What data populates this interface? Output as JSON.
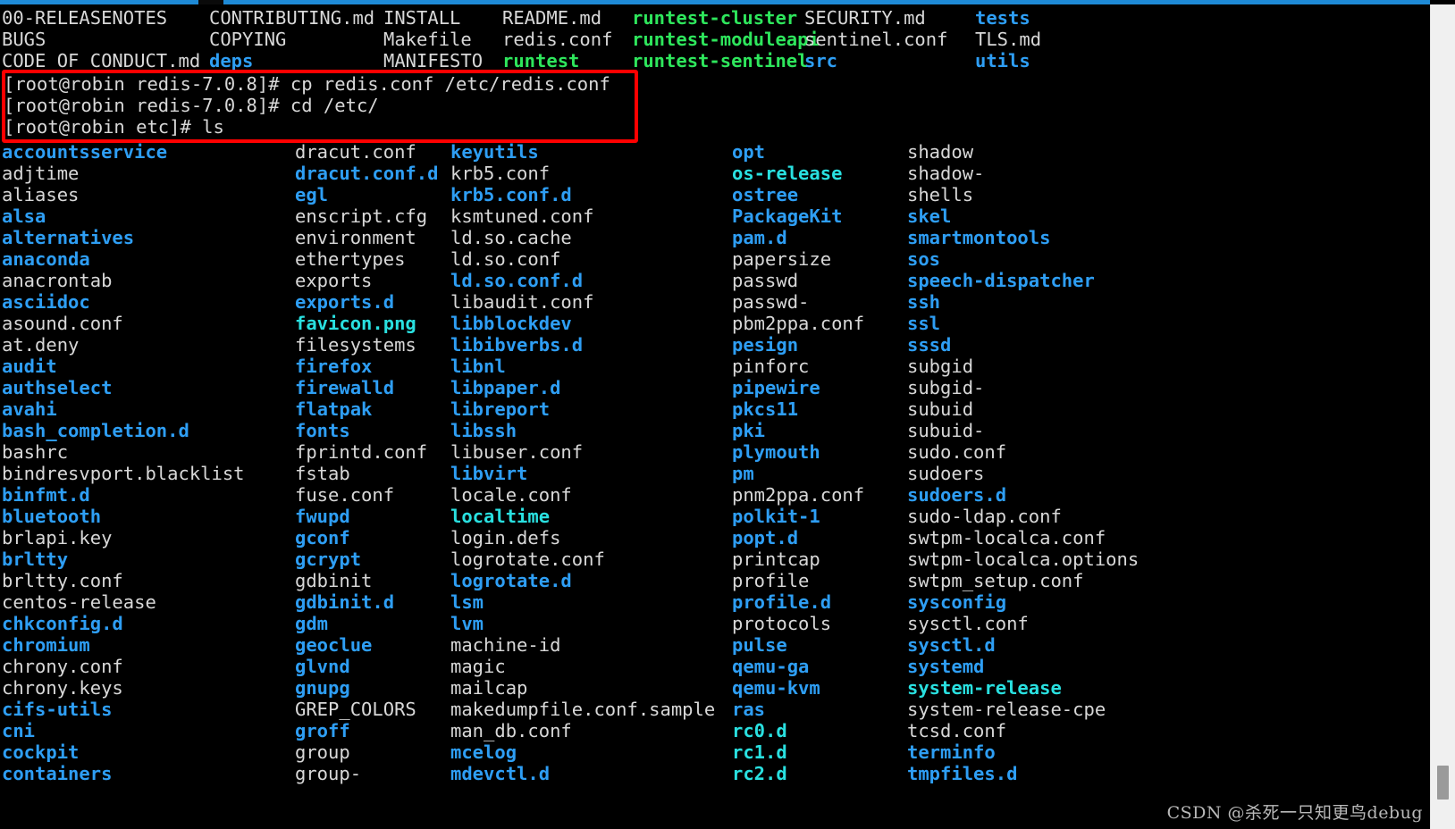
{
  "window": {
    "top_edge_color": "#1e8ad6",
    "background_color": "#000000"
  },
  "terminal": {
    "colors": {
      "white": "#d8d8d8",
      "directory_blue": "#2e9ef4",
      "executable_green": "#2ee65c",
      "symlink_cyan": "#29e0e0",
      "highlight_red": "#ff0000"
    },
    "previous_listing": {
      "description": "output of ls in redis-7.0.8 source directory",
      "rows": [
        [
          {
            "t": "00-RELEASENOTES",
            "c": "white"
          },
          {
            "t": "CONTRIBUTING.md",
            "c": "white"
          },
          {
            "t": "INSTALL",
            "c": "white"
          },
          {
            "t": "README.md",
            "c": "white"
          },
          {
            "t": "runtest-cluster",
            "c": "green"
          },
          {
            "t": "SECURITY.md",
            "c": "white"
          },
          {
            "t": "tests",
            "c": "blue"
          }
        ],
        [
          {
            "t": "BUGS",
            "c": "white"
          },
          {
            "t": "COPYING",
            "c": "white"
          },
          {
            "t": "Makefile",
            "c": "white"
          },
          {
            "t": "redis.conf",
            "c": "white"
          },
          {
            "t": "runtest-moduleapi",
            "c": "green"
          },
          {
            "t": "sentinel.conf",
            "c": "white"
          },
          {
            "t": "TLS.md",
            "c": "white"
          }
        ],
        [
          {
            "t": "CODE_OF_CONDUCT.md",
            "c": "white"
          },
          {
            "t": "deps",
            "c": "blue"
          },
          {
            "t": "MANIFESTO",
            "c": "white"
          },
          {
            "t": "runtest",
            "c": "green"
          },
          {
            "t": "runtest-sentinel",
            "c": "green"
          },
          {
            "t": "src",
            "c": "blue"
          },
          {
            "t": "utils",
            "c": "blue"
          }
        ]
      ]
    },
    "commands": [
      "[root@robin redis-7.0.8]# cp redis.conf /etc/redis.conf",
      "[root@robin redis-7.0.8]# cd /etc/",
      "[root@robin etc]# ls"
    ],
    "etc_listing": {
      "description": "output of ls in /etc",
      "rows": [
        [
          {
            "t": "accountsservice",
            "c": "blue"
          },
          {
            "t": "dracut.conf",
            "c": "white"
          },
          {
            "t": "keyutils",
            "c": "blue"
          },
          {
            "t": "opt",
            "c": "blue"
          },
          {
            "t": "shadow",
            "c": "white"
          }
        ],
        [
          {
            "t": "adjtime",
            "c": "white"
          },
          {
            "t": "dracut.conf.d",
            "c": "blue"
          },
          {
            "t": "krb5.conf",
            "c": "white"
          },
          {
            "t": "os-release",
            "c": "cyan"
          },
          {
            "t": "shadow-",
            "c": "white"
          }
        ],
        [
          {
            "t": "aliases",
            "c": "white"
          },
          {
            "t": "egl",
            "c": "blue"
          },
          {
            "t": "krb5.conf.d",
            "c": "blue"
          },
          {
            "t": "ostree",
            "c": "blue"
          },
          {
            "t": "shells",
            "c": "white"
          }
        ],
        [
          {
            "t": "alsa",
            "c": "blue"
          },
          {
            "t": "enscript.cfg",
            "c": "white"
          },
          {
            "t": "ksmtuned.conf",
            "c": "white"
          },
          {
            "t": "PackageKit",
            "c": "blue"
          },
          {
            "t": "skel",
            "c": "blue"
          }
        ],
        [
          {
            "t": "alternatives",
            "c": "blue"
          },
          {
            "t": "environment",
            "c": "white"
          },
          {
            "t": "ld.so.cache",
            "c": "white"
          },
          {
            "t": "pam.d",
            "c": "blue"
          },
          {
            "t": "smartmontools",
            "c": "blue"
          }
        ],
        [
          {
            "t": "anaconda",
            "c": "blue"
          },
          {
            "t": "ethertypes",
            "c": "white"
          },
          {
            "t": "ld.so.conf",
            "c": "white"
          },
          {
            "t": "papersize",
            "c": "white"
          },
          {
            "t": "sos",
            "c": "blue"
          }
        ],
        [
          {
            "t": "anacrontab",
            "c": "white"
          },
          {
            "t": "exports",
            "c": "white"
          },
          {
            "t": "ld.so.conf.d",
            "c": "blue"
          },
          {
            "t": "passwd",
            "c": "white"
          },
          {
            "t": "speech-dispatcher",
            "c": "blue"
          }
        ],
        [
          {
            "t": "asciidoc",
            "c": "blue"
          },
          {
            "t": "exports.d",
            "c": "blue"
          },
          {
            "t": "libaudit.conf",
            "c": "white"
          },
          {
            "t": "passwd-",
            "c": "white"
          },
          {
            "t": "ssh",
            "c": "blue"
          }
        ],
        [
          {
            "t": "asound.conf",
            "c": "white"
          },
          {
            "t": "favicon.png",
            "c": "cyan"
          },
          {
            "t": "libblockdev",
            "c": "blue"
          },
          {
            "t": "pbm2ppa.conf",
            "c": "white"
          },
          {
            "t": "ssl",
            "c": "blue"
          }
        ],
        [
          {
            "t": "at.deny",
            "c": "white"
          },
          {
            "t": "filesystems",
            "c": "white"
          },
          {
            "t": "libibverbs.d",
            "c": "blue"
          },
          {
            "t": "pesign",
            "c": "blue"
          },
          {
            "t": "sssd",
            "c": "blue"
          }
        ],
        [
          {
            "t": "audit",
            "c": "blue"
          },
          {
            "t": "firefox",
            "c": "blue"
          },
          {
            "t": "libnl",
            "c": "blue"
          },
          {
            "t": "pinforc",
            "c": "white"
          },
          {
            "t": "subgid",
            "c": "white"
          }
        ],
        [
          {
            "t": "authselect",
            "c": "blue"
          },
          {
            "t": "firewalld",
            "c": "blue"
          },
          {
            "t": "libpaper.d",
            "c": "blue"
          },
          {
            "t": "pipewire",
            "c": "blue"
          },
          {
            "t": "subgid-",
            "c": "white"
          }
        ],
        [
          {
            "t": "avahi",
            "c": "blue"
          },
          {
            "t": "flatpak",
            "c": "blue"
          },
          {
            "t": "libreport",
            "c": "blue"
          },
          {
            "t": "pkcs11",
            "c": "blue"
          },
          {
            "t": "subuid",
            "c": "white"
          }
        ],
        [
          {
            "t": "bash_completion.d",
            "c": "blue"
          },
          {
            "t": "fonts",
            "c": "blue"
          },
          {
            "t": "libssh",
            "c": "blue"
          },
          {
            "t": "pki",
            "c": "blue"
          },
          {
            "t": "subuid-",
            "c": "white"
          }
        ],
        [
          {
            "t": "bashrc",
            "c": "white"
          },
          {
            "t": "fprintd.conf",
            "c": "white"
          },
          {
            "t": "libuser.conf",
            "c": "white"
          },
          {
            "t": "plymouth",
            "c": "blue"
          },
          {
            "t": "sudo.conf",
            "c": "white"
          }
        ],
        [
          {
            "t": "bindresvport.blacklist",
            "c": "white"
          },
          {
            "t": "fstab",
            "c": "white"
          },
          {
            "t": "libvirt",
            "c": "blue"
          },
          {
            "t": "pm",
            "c": "blue"
          },
          {
            "t": "sudoers",
            "c": "white"
          }
        ],
        [
          {
            "t": "binfmt.d",
            "c": "blue"
          },
          {
            "t": "fuse.conf",
            "c": "white"
          },
          {
            "t": "locale.conf",
            "c": "white"
          },
          {
            "t": "pnm2ppa.conf",
            "c": "white"
          },
          {
            "t": "sudoers.d",
            "c": "blue"
          }
        ],
        [
          {
            "t": "bluetooth",
            "c": "blue"
          },
          {
            "t": "fwupd",
            "c": "blue"
          },
          {
            "t": "localtime",
            "c": "cyan"
          },
          {
            "t": "polkit-1",
            "c": "blue"
          },
          {
            "t": "sudo-ldap.conf",
            "c": "white"
          }
        ],
        [
          {
            "t": "brlapi.key",
            "c": "white"
          },
          {
            "t": "gconf",
            "c": "blue"
          },
          {
            "t": "login.defs",
            "c": "white"
          },
          {
            "t": "popt.d",
            "c": "blue"
          },
          {
            "t": "swtpm-localca.conf",
            "c": "white"
          }
        ],
        [
          {
            "t": "brltty",
            "c": "blue"
          },
          {
            "t": "gcrypt",
            "c": "blue"
          },
          {
            "t": "logrotate.conf",
            "c": "white"
          },
          {
            "t": "printcap",
            "c": "white"
          },
          {
            "t": "swtpm-localca.options",
            "c": "white"
          }
        ],
        [
          {
            "t": "brltty.conf",
            "c": "white"
          },
          {
            "t": "gdbinit",
            "c": "white"
          },
          {
            "t": "logrotate.d",
            "c": "blue"
          },
          {
            "t": "profile",
            "c": "white"
          },
          {
            "t": "swtpm_setup.conf",
            "c": "white"
          }
        ],
        [
          {
            "t": "centos-release",
            "c": "white"
          },
          {
            "t": "gdbinit.d",
            "c": "blue"
          },
          {
            "t": "lsm",
            "c": "blue"
          },
          {
            "t": "profile.d",
            "c": "blue"
          },
          {
            "t": "sysconfig",
            "c": "blue"
          }
        ],
        [
          {
            "t": "chkconfig.d",
            "c": "blue"
          },
          {
            "t": "gdm",
            "c": "blue"
          },
          {
            "t": "lvm",
            "c": "blue"
          },
          {
            "t": "protocols",
            "c": "white"
          },
          {
            "t": "sysctl.conf",
            "c": "white"
          }
        ],
        [
          {
            "t": "chromium",
            "c": "blue"
          },
          {
            "t": "geoclue",
            "c": "blue"
          },
          {
            "t": "machine-id",
            "c": "white"
          },
          {
            "t": "pulse",
            "c": "blue"
          },
          {
            "t": "sysctl.d",
            "c": "blue"
          }
        ],
        [
          {
            "t": "chrony.conf",
            "c": "white"
          },
          {
            "t": "glvnd",
            "c": "blue"
          },
          {
            "t": "magic",
            "c": "white"
          },
          {
            "t": "qemu-ga",
            "c": "blue"
          },
          {
            "t": "systemd",
            "c": "blue"
          }
        ],
        [
          {
            "t": "chrony.keys",
            "c": "white"
          },
          {
            "t": "gnupg",
            "c": "blue"
          },
          {
            "t": "mailcap",
            "c": "white"
          },
          {
            "t": "qemu-kvm",
            "c": "blue"
          },
          {
            "t": "system-release",
            "c": "cyan"
          }
        ],
        [
          {
            "t": "cifs-utils",
            "c": "blue"
          },
          {
            "t": "GREP_COLORS",
            "c": "white"
          },
          {
            "t": "makedumpfile.conf.sample",
            "c": "white"
          },
          {
            "t": "ras",
            "c": "blue"
          },
          {
            "t": "system-release-cpe",
            "c": "white"
          }
        ],
        [
          {
            "t": "cni",
            "c": "blue"
          },
          {
            "t": "groff",
            "c": "blue"
          },
          {
            "t": "man_db.conf",
            "c": "white"
          },
          {
            "t": "rc0.d",
            "c": "cyan"
          },
          {
            "t": "tcsd.conf",
            "c": "white"
          }
        ],
        [
          {
            "t": "cockpit",
            "c": "blue"
          },
          {
            "t": "group",
            "c": "white"
          },
          {
            "t": "mcelog",
            "c": "blue"
          },
          {
            "t": "rc1.d",
            "c": "cyan"
          },
          {
            "t": "terminfo",
            "c": "blue"
          }
        ],
        [
          {
            "t": "containers",
            "c": "blue"
          },
          {
            "t": "group-",
            "c": "white"
          },
          {
            "t": "mdevctl.d",
            "c": "blue"
          },
          {
            "t": "rc2.d",
            "c": "cyan"
          },
          {
            "t": "tmpfiles.d",
            "c": "blue"
          }
        ]
      ]
    }
  },
  "watermark": "CSDN @杀死一只知更鸟debug"
}
